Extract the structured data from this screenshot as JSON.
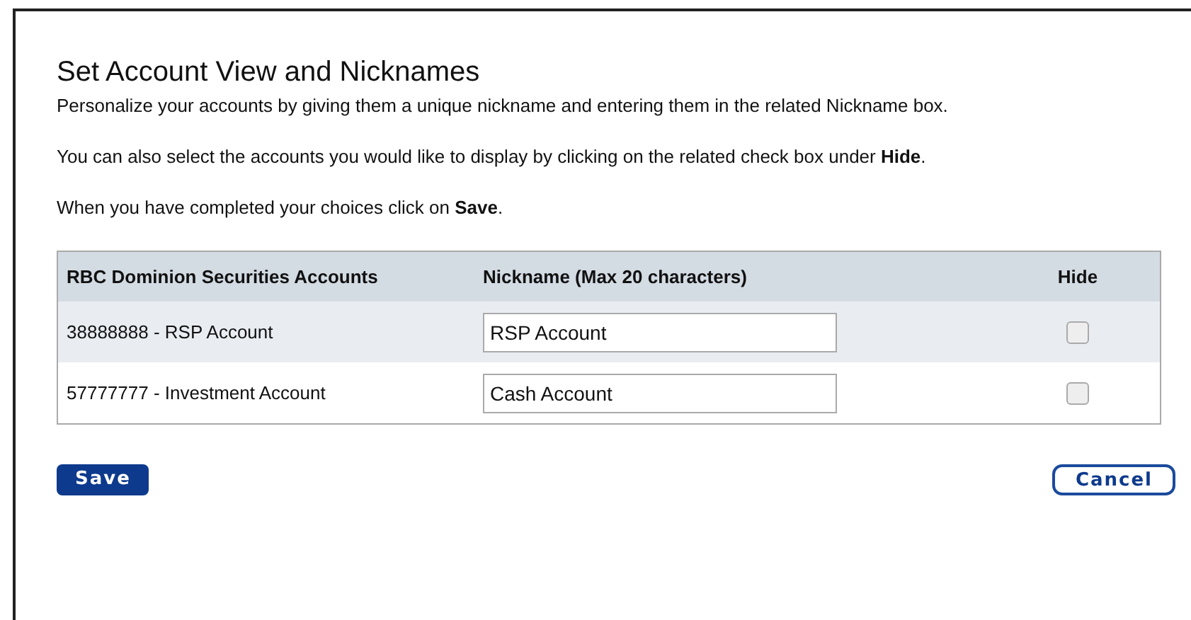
{
  "title": "Set Account View and Nicknames",
  "paragraphs": [
    "Personalize your accounts by giving them a unique nickname and entering them in the related Nickname box.",
    "You can also select the accounts you would like to display by clicking on the related check box under **Hide**.",
    "When you have completed your choices click on **Save**."
  ],
  "table": {
    "columns": [
      "RBC Dominion Securities Accounts",
      "Nickname (Max 20 characters)",
      "Hide"
    ],
    "rows": [
      {
        "account": "38888888 - RSP Account",
        "nickname": "RSP Account",
        "hidden": false
      },
      {
        "account": "57777777 - Investment Account",
        "nickname": "Cash Account",
        "hidden": false
      }
    ]
  },
  "buttons": {
    "save": "Save",
    "cancel": "Cancel"
  }
}
